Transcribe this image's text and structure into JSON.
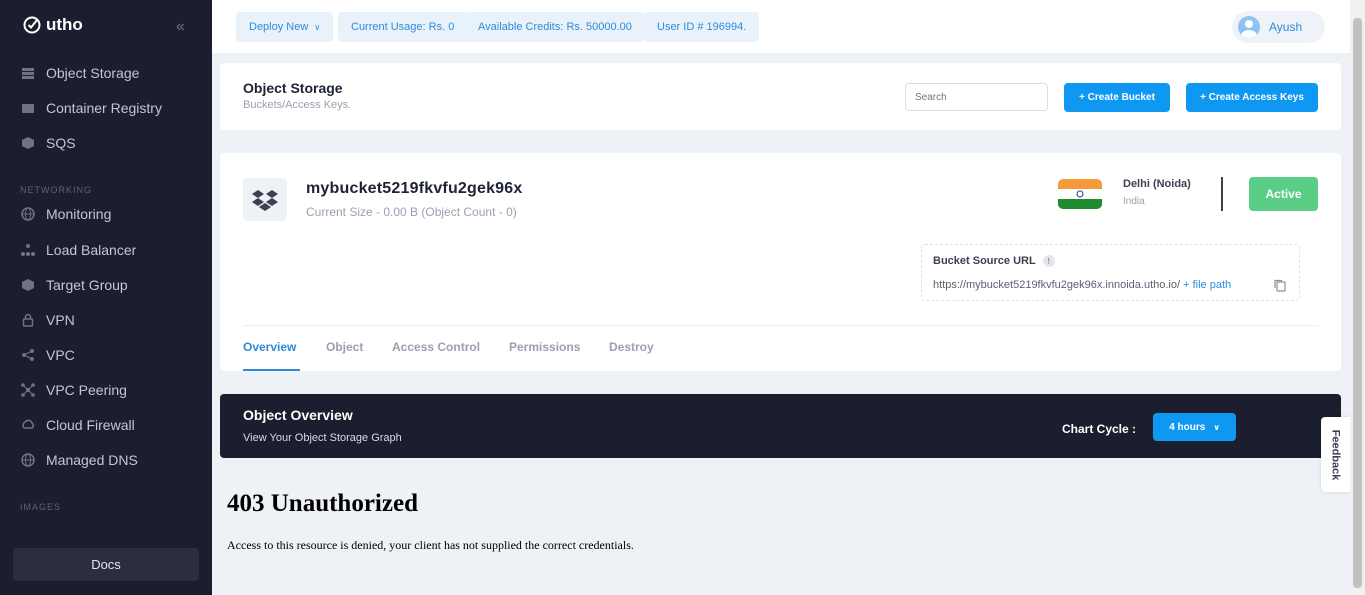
{
  "app": {
    "logo_text": "utho"
  },
  "sidebar": {
    "items_top": [
      {
        "label": "Object Storage",
        "icon": "object-storage-icon"
      },
      {
        "label": "Container Registry",
        "icon": "container-icon"
      },
      {
        "label": "SQS",
        "icon": "sqs-icon"
      }
    ],
    "section_networking": "NETWORKING",
    "items_net": [
      {
        "label": "Monitoring",
        "icon": "globe-icon"
      },
      {
        "label": "Load Balancer",
        "icon": "load-balancer-icon"
      },
      {
        "label": "Target Group",
        "icon": "target-group-icon"
      },
      {
        "label": "VPN",
        "icon": "lock-icon"
      },
      {
        "label": "VPC",
        "icon": "share-icon"
      },
      {
        "label": "VPC Peering",
        "icon": "peering-icon"
      },
      {
        "label": "Cloud Firewall",
        "icon": "firewall-icon"
      },
      {
        "label": "Managed DNS",
        "icon": "globe-icon"
      }
    ],
    "section_images": "IMAGES",
    "docs_label": "Docs"
  },
  "topbar": {
    "deploy": "Deploy New",
    "usage": "Current Usage: Rs. 0",
    "credits": "Available Credits: Rs. 50000.00",
    "userid": "User ID # 196994.",
    "user_name": "Ayush"
  },
  "header": {
    "title": "Object Storage",
    "subtitle": "Buckets/Access Keys.",
    "search_placeholder": "Search",
    "create_bucket": "+ Create Bucket",
    "create_keys": "+ Create Access Keys"
  },
  "bucket": {
    "name": "mybucket5219fkvfu2gek96x",
    "size": "Current Size -  0.00 B  (Object Count - 0)",
    "location": "Delhi (Noida)",
    "country": "India",
    "status": "Active",
    "source_label": "Bucket Source URL",
    "source_url": "https://mybucket5219fkvfu2gek96x.innoida.utho.io/",
    "file_path": " + file path",
    "flag_colors": [
      "#f59a3b",
      "#ffffff",
      "#1f8a2f"
    ]
  },
  "tabs": [
    "Overview",
    "Object",
    "Access Control",
    "Permissions",
    "Destroy"
  ],
  "overview": {
    "title": "Object Overview",
    "subtitle": "View Your Object Storage Graph",
    "cycle_label": "Chart Cycle :",
    "cycle_value": "4 hours"
  },
  "error": {
    "title": "403 Unauthorized",
    "message": "Access to this resource is denied, your client has not supplied the correct credentials."
  },
  "feedback": "Feedback"
}
